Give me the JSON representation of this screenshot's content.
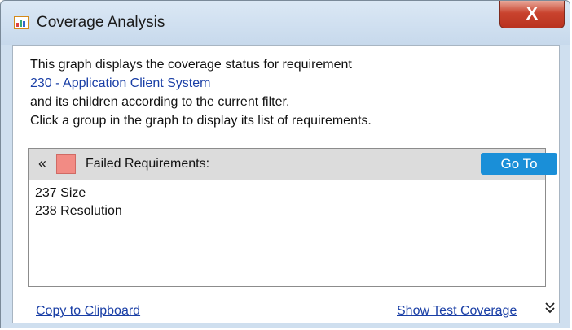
{
  "window": {
    "title": "Coverage Analysis",
    "close_label": "X"
  },
  "description": {
    "line1": "This graph displays the coverage status for requirement",
    "requirement_link": "230 - Application Client System",
    "line3": "and its children according to the current filter.",
    "line4": "Click a group in the graph to display its list of requirements."
  },
  "group": {
    "collapse_glyph": "«",
    "swatch_color": "#f28b84",
    "title": "Failed Requirements:",
    "goto_label": "Go To",
    "items": [
      {
        "label": "237 Size"
      },
      {
        "label": "238 Resolution"
      }
    ]
  },
  "footer": {
    "copy_label": "Copy to Clipboard",
    "show_coverage_label": "Show Test Coverage",
    "expand_glyph": "»"
  },
  "icons": {
    "title_icon": "chart-icon",
    "collapse": "double-chevron-left-icon",
    "expand": "double-chevron-down-icon"
  }
}
